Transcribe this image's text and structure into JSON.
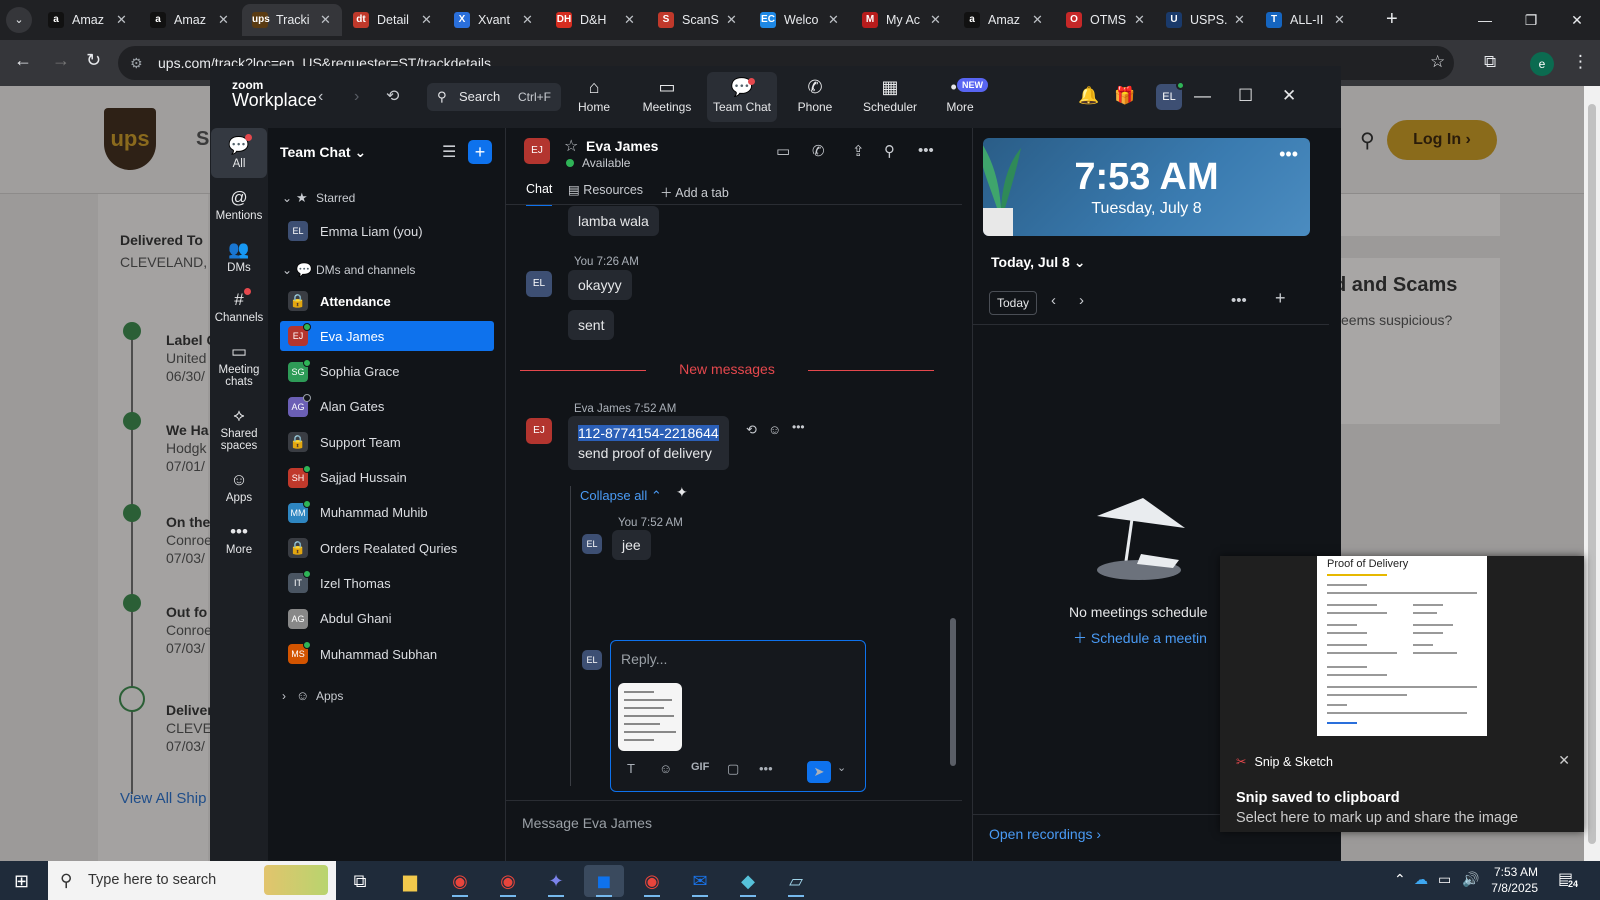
{
  "browser": {
    "tabs": [
      {
        "title": "Amaz",
        "favicon": "a",
        "color": "#111111",
        "active": false
      },
      {
        "title": "Amaz",
        "favicon": "a",
        "color": "#111111",
        "active": false
      },
      {
        "title": "Tracki",
        "favicon": "ups",
        "color": "#5a3b12",
        "active": true
      },
      {
        "title": "Detail",
        "favicon": "dt",
        "color": "#c0392b",
        "active": false
      },
      {
        "title": "Xvant",
        "favicon": "X",
        "color": "#2a6fdb",
        "active": false
      },
      {
        "title": "D&H",
        "favicon": "DH",
        "color": "#d62d20",
        "active": false
      },
      {
        "title": "ScanS",
        "favicon": "S",
        "color": "#c0392b",
        "active": false
      },
      {
        "title": "Welco",
        "favicon": "EC",
        "color": "#1e88e5",
        "active": false
      },
      {
        "title": "My Ac",
        "favicon": "M",
        "color": "#b71c1c",
        "active": false
      },
      {
        "title": "Amaz",
        "favicon": "a",
        "color": "#111111",
        "active": false
      },
      {
        "title": "OTMS",
        "favicon": "O",
        "color": "#c62828",
        "active": false
      },
      {
        "title": "USPS.",
        "favicon": "U",
        "color": "#1a3a6b",
        "active": false
      },
      {
        "title": "ALL-II",
        "favicon": "T",
        "color": "#1565c0",
        "active": false
      }
    ],
    "url": "ups.com/track?loc=en_US&requester=ST/trackdetails",
    "profile_initial": "e"
  },
  "ups": {
    "login_label": "Log In ›",
    "s_fragment": "S",
    "delivered_to_label": "Delivered To",
    "delivered_to_value": "CLEVELAND, T",
    "steps": [
      {
        "title": "Label C",
        "line1": "United",
        "line2": "06/30/"
      },
      {
        "title": "We Ha",
        "line1": "Hodgk",
        "line2": "07/01/"
      },
      {
        "title": "On the",
        "line1": "Conroe",
        "line2": "07/03/"
      },
      {
        "title": "Out fo",
        "line1": "Conroe",
        "line2": "07/03/"
      },
      {
        "title": "Deliver",
        "line1": "CLEVE",
        "line2": "07/03/"
      }
    ],
    "view_all": "View All Ship",
    "scams_title": "d and Scams",
    "scams_body": "seems suspicious?"
  },
  "zoom": {
    "logo_top": "zoom",
    "logo_bottom": "Workplace",
    "search_label": "Search",
    "search_shortcut": "Ctrl+F",
    "nav_tabs": [
      {
        "label": "Home",
        "icon": "⌂"
      },
      {
        "label": "Meetings",
        "icon": "▭"
      },
      {
        "label": "Team Chat",
        "icon": "💬"
      },
      {
        "label": "Phone",
        "icon": "✆"
      },
      {
        "label": "Scheduler",
        "icon": "▦"
      },
      {
        "label": "More",
        "icon": "•••"
      }
    ],
    "new_badge": "NEW",
    "user_initials": "EL",
    "rail": [
      {
        "label": "All",
        "icon": "💬"
      },
      {
        "label": "Mentions",
        "icon": "@"
      },
      {
        "label": "DMs",
        "icon": "👥"
      },
      {
        "label": "Channels",
        "icon": "#"
      },
      {
        "label": "Meeting chats",
        "icon": "▭"
      },
      {
        "label": "Shared spaces",
        "icon": "⟡"
      },
      {
        "label": "Apps",
        "icon": "☺"
      },
      {
        "label": "More",
        "icon": "•••"
      }
    ],
    "team_chat": {
      "title": "Team Chat",
      "starred_label": "Starred",
      "dms_label": "DMs and channels",
      "apps_label": "Apps",
      "starred": [
        {
          "initials": "EL",
          "name": "Emma Liam (you)",
          "color": "#3d4f73"
        }
      ],
      "items": [
        {
          "name": "Attendance",
          "type": "channel",
          "bold": true
        },
        {
          "name": "Eva James",
          "initials": "EJ",
          "color": "#b3352f",
          "active": true,
          "status": "online"
        },
        {
          "name": "Sophia Grace",
          "initials": "SG",
          "color": "#2e9b57",
          "status": "online"
        },
        {
          "name": "Alan Gates",
          "initials": "AG",
          "color": "#6b5fb5",
          "status": "away"
        },
        {
          "name": "Support Team",
          "type": "channel"
        },
        {
          "name": "Sajjad Hussain",
          "initials": "SH",
          "color": "#c0392b",
          "status": "online"
        },
        {
          "name": "Muhammad Muhib",
          "initials": "MM",
          "color": "#2e86c1",
          "status": "online"
        },
        {
          "name": "Orders Realated Quries",
          "type": "channel"
        },
        {
          "name": "Izel Thomas",
          "initials": "IT",
          "color": "#4a5562",
          "status": "online"
        },
        {
          "name": "Abdul Ghani",
          "initials": "AG",
          "color": "#888888",
          "status": "none"
        },
        {
          "name": "Muhammad Subhan",
          "initials": "MS",
          "color": "#d35400",
          "status": "online"
        }
      ]
    },
    "chat": {
      "contact": "Eva James",
      "contact_initials": "EJ",
      "status": "Available",
      "tabs": [
        "Chat",
        "Resources",
        "Add a tab"
      ],
      "messages": {
        "m0": "lamba wala",
        "you_meta": "You 7:26 AM",
        "m1": "okayyy",
        "m2": "sent",
        "new_messages": "New messages",
        "eva_meta": "Eva James 7:52 AM",
        "tracking": "112-8774154-2218644",
        "m3": "send proof of delivery",
        "collapse": "Collapse all",
        "reply_meta": "You 7:52 AM",
        "m4": "jee"
      },
      "reply_placeholder": "Reply...",
      "message_placeholder": "Message Eva James",
      "me_initials": "EL"
    },
    "calendar": {
      "time": "7:53 AM",
      "date": "Tuesday, July 8",
      "today_header": "Today, Jul 8",
      "today_button": "Today",
      "empty": "No meetings schedule",
      "schedule": "Schedule a meetin",
      "open_recordings": "Open recordings"
    }
  },
  "snip": {
    "preview_title": "Proof of Delivery",
    "app": "Snip & Sketch",
    "title": "Snip saved to clipboard",
    "body": "Select here to mark up and share the image"
  },
  "taskbar": {
    "search_placeholder": "Type here to search",
    "time": "7:53 AM",
    "date": "7/8/2025",
    "notification_count": "24"
  }
}
